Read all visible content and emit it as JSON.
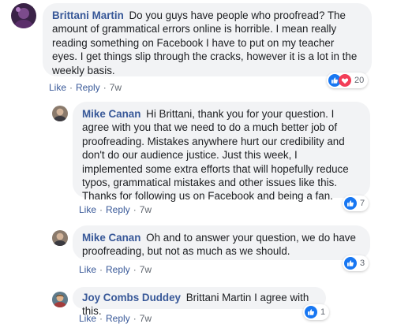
{
  "comments": [
    {
      "author": "Brittani Martin",
      "text": "Do you guys have people who proofread? The amount of grammatical errors online is horrible. I mean really reading something on Facebook I have to put on my teacher eyes. I get things slip through the cracks, however it is a lot in the weekly basis.",
      "like": "Like",
      "reply": "Reply",
      "sep": "·",
      "time": "7w",
      "reaction_count": "20",
      "reaction_icons": [
        "like-icon",
        "love-icon"
      ]
    },
    {
      "author": "Mike Canan",
      "text": "Hi Brittani, thank you for your question. I agree with you that we need to do a much better job of proofreading. Mistakes anywhere hurt our credibility and don't do our audience justice. Just this week, I implemented some extra efforts that will hopefully reduce typos, grammatical mistakes and other issues like this. Thanks for following us on Facebook and being a fan.",
      "like": "Like",
      "reply": "Reply",
      "sep": "·",
      "time": "7w",
      "reaction_count": "7",
      "reaction_icons": [
        "like-icon"
      ]
    },
    {
      "author": "Mike Canan",
      "text": "Oh and to answer your question, we do have proofreading, but not as much as we should.",
      "like": "Like",
      "reply": "Reply",
      "sep": "·",
      "time": "7w",
      "reaction_count": "3",
      "reaction_icons": [
        "like-icon"
      ]
    },
    {
      "author": "Joy Combs Duddey",
      "text": "Brittani Martin I agree with this.",
      "like": "Like",
      "reply": "Reply",
      "sep": "·",
      "time": "7w",
      "reaction_count": "1",
      "reaction_icons": [
        "like-icon"
      ]
    }
  ],
  "colors": {
    "author": "#385898",
    "bubble": "#f2f3f5",
    "like": "#1877f2",
    "love": "#f33e58",
    "meta": "#616770"
  }
}
